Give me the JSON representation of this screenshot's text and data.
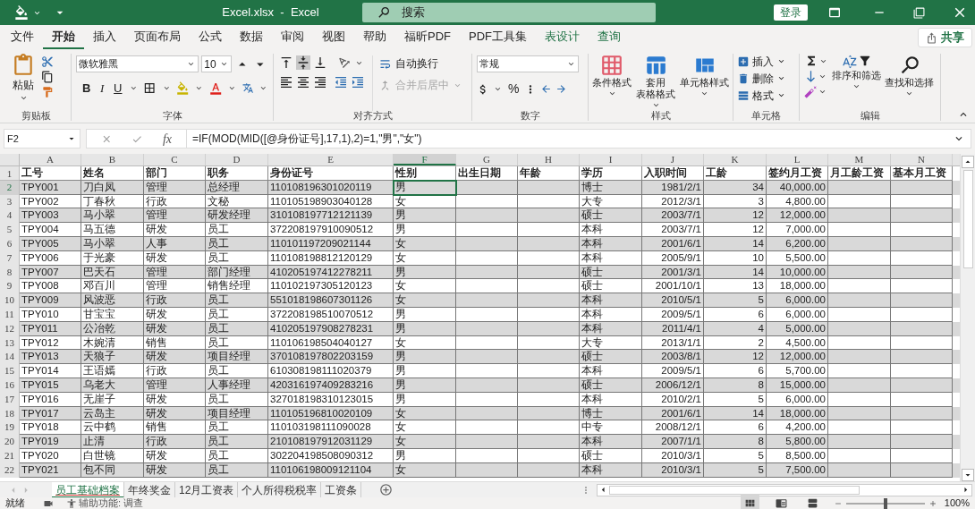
{
  "title_bar": {
    "title": "Excel.xlsx  -  Excel",
    "search": {
      "placeholder": "搜索"
    },
    "sign_in": "登录"
  },
  "menu_tabs": [
    {
      "label": "文件",
      "selected": false,
      "kind": "normal"
    },
    {
      "label": "开始",
      "selected": true,
      "kind": "normal"
    },
    {
      "label": "插入",
      "selected": false,
      "kind": "normal"
    },
    {
      "label": "页面布局",
      "selected": false,
      "kind": "normal"
    },
    {
      "label": "公式",
      "selected": false,
      "kind": "normal"
    },
    {
      "label": "数据",
      "selected": false,
      "kind": "normal"
    },
    {
      "label": "审阅",
      "selected": false,
      "kind": "normal"
    },
    {
      "label": "视图",
      "selected": false,
      "kind": "normal"
    },
    {
      "label": "帮助",
      "selected": false,
      "kind": "normal"
    },
    {
      "label": "福昕PDF",
      "selected": false,
      "kind": "normal"
    },
    {
      "label": "PDF工具集",
      "selected": false,
      "kind": "normal"
    },
    {
      "label": "表设计",
      "selected": false,
      "kind": "contextual"
    },
    {
      "label": "查询",
      "selected": false,
      "kind": "contextual"
    }
  ],
  "share_button": "共享",
  "ribbon": {
    "clipboard": {
      "paste": "粘贴",
      "label": "剪贴板"
    },
    "font": {
      "font_name": "微软雅黑",
      "font_size": "10",
      "bold": "B",
      "italic": "I",
      "underline": "U",
      "label": "字体"
    },
    "alignment": {
      "wrap_text": "自动换行",
      "merge_center": {
        "label": "合并后居中",
        "disabled": true
      },
      "label": "对齐方式"
    },
    "number": {
      "format": "常规",
      "percent": "%",
      "label": "数字"
    },
    "styles": {
      "items": [
        [
          "条件格式"
        ],
        [
          "套用",
          "表格格式"
        ],
        [
          "单元格样式"
        ]
      ],
      "label": "样式"
    },
    "cells": {
      "items": [
        "插入",
        "删除",
        "格式"
      ],
      "label": "单元格"
    },
    "editing": {
      "sort_filter": "排序和筛选",
      "find_select": "查找和选择",
      "label": "编辑"
    }
  },
  "formula_bar": {
    "name_box": "F2",
    "function_label": "fx",
    "formula": "=IF(MOD(MID([@身份证号],17,1),2)=1,\"男\",\"女\")"
  },
  "columns": [
    {
      "label": "A",
      "selected": false
    },
    {
      "label": "B",
      "selected": false
    },
    {
      "label": "C",
      "selected": false
    },
    {
      "label": "D",
      "selected": false
    },
    {
      "label": "E",
      "selected": false
    },
    {
      "label": "F",
      "selected": true
    },
    {
      "label": "G",
      "selected": false
    },
    {
      "label": "H",
      "selected": false
    },
    {
      "label": "I",
      "selected": false
    },
    {
      "label": "J",
      "selected": false
    },
    {
      "label": "K",
      "selected": false
    },
    {
      "label": "L",
      "selected": false
    },
    {
      "label": "M",
      "selected": false
    },
    {
      "label": "N",
      "selected": false
    }
  ],
  "header_row": {
    "row_number": "1",
    "cells": [
      "工号",
      "姓名",
      "部门",
      "职务",
      "身份证号",
      "性别",
      "出生日期",
      "年龄",
      "学历",
      "入职时间",
      "工龄",
      "签约月工资",
      "月工龄工资",
      "基本月工资"
    ]
  },
  "rows": [
    {
      "row_number": "2",
      "selected": true,
      "id": "TPY001",
      "name": "刀白凤",
      "dept": "管理",
      "position": "总经理",
      "id_number": "110108196301020119",
      "gender": "男",
      "education": "博士",
      "hire_date": "1981/2/1",
      "years": "34",
      "salary": "40,000.00"
    },
    {
      "row_number": "3",
      "selected": false,
      "id": "TPY002",
      "name": "丁春秋",
      "dept": "行政",
      "position": "文秘",
      "id_number": "110105198903040128",
      "gender": "女",
      "education": "大专",
      "hire_date": "2012/3/1",
      "years": "3",
      "salary": "4,800.00"
    },
    {
      "row_number": "4",
      "selected": false,
      "id": "TPY003",
      "name": "马小翠",
      "dept": "管理",
      "position": "研发经理",
      "id_number": "310108197712121139",
      "gender": "男",
      "education": "硕士",
      "hire_date": "2003/7/1",
      "years": "12",
      "salary": "12,000.00"
    },
    {
      "row_number": "5",
      "selected": false,
      "id": "TPY004",
      "name": "马五德",
      "dept": "研发",
      "position": "员工",
      "id_number": "372208197910090512",
      "gender": "男",
      "education": "本科",
      "hire_date": "2003/7/1",
      "years": "12",
      "salary": "7,000.00"
    },
    {
      "row_number": "6",
      "selected": false,
      "id": "TPY005",
      "name": "马小翠",
      "dept": "人事",
      "position": "员工",
      "id_number": "110101197209021144",
      "gender": "女",
      "education": "本科",
      "hire_date": "2001/6/1",
      "years": "14",
      "salary": "6,200.00"
    },
    {
      "row_number": "7",
      "selected": false,
      "id": "TPY006",
      "name": "于光豪",
      "dept": "研发",
      "position": "员工",
      "id_number": "110108198812120129",
      "gender": "女",
      "education": "本科",
      "hire_date": "2005/9/1",
      "years": "10",
      "salary": "5,500.00"
    },
    {
      "row_number": "8",
      "selected": false,
      "id": "TPY007",
      "name": "巴天石",
      "dept": "管理",
      "position": "部门经理",
      "id_number": "410205197412278211",
      "gender": "男",
      "education": "硕士",
      "hire_date": "2001/3/1",
      "years": "14",
      "salary": "10,000.00"
    },
    {
      "row_number": "9",
      "selected": false,
      "id": "TPY008",
      "name": "邓百川",
      "dept": "管理",
      "position": "销售经理",
      "id_number": "110102197305120123",
      "gender": "女",
      "education": "硕士",
      "hire_date": "2001/10/1",
      "years": "13",
      "salary": "18,000.00"
    },
    {
      "row_number": "10",
      "selected": false,
      "id": "TPY009",
      "name": "风波恶",
      "dept": "行政",
      "position": "员工",
      "id_number": "551018198607301126",
      "gender": "女",
      "education": "本科",
      "hire_date": "2010/5/1",
      "years": "5",
      "salary": "6,000.00"
    },
    {
      "row_number": "11",
      "selected": false,
      "id": "TPY010",
      "name": "甘宝宝",
      "dept": "研发",
      "position": "员工",
      "id_number": "372208198510070512",
      "gender": "男",
      "education": "本科",
      "hire_date": "2009/5/1",
      "years": "6",
      "salary": "6,000.00"
    },
    {
      "row_number": "12",
      "selected": false,
      "id": "TPY011",
      "name": "公冶乾",
      "dept": "研发",
      "position": "员工",
      "id_number": "410205197908278231",
      "gender": "男",
      "education": "本科",
      "hire_date": "2011/4/1",
      "years": "4",
      "salary": "5,000.00"
    },
    {
      "row_number": "13",
      "selected": false,
      "id": "TPY012",
      "name": "木婉清",
      "dept": "销售",
      "position": "员工",
      "id_number": "110106198504040127",
      "gender": "女",
      "education": "大专",
      "hire_date": "2013/1/1",
      "years": "2",
      "salary": "4,500.00"
    },
    {
      "row_number": "14",
      "selected": false,
      "id": "TPY013",
      "name": "天狼子",
      "dept": "研发",
      "position": "项目经理",
      "id_number": "370108197802203159",
      "gender": "男",
      "education": "硕士",
      "hire_date": "2003/8/1",
      "years": "12",
      "salary": "12,000.00"
    },
    {
      "row_number": "15",
      "selected": false,
      "id": "TPY014",
      "name": "王语嫣",
      "dept": "行政",
      "position": "员工",
      "id_number": "610308198111020379",
      "gender": "男",
      "education": "本科",
      "hire_date": "2009/5/1",
      "years": "6",
      "salary": "5,700.00"
    },
    {
      "row_number": "16",
      "selected": false,
      "id": "TPY015",
      "name": "乌老大",
      "dept": "管理",
      "position": "人事经理",
      "id_number": "420316197409283216",
      "gender": "男",
      "education": "硕士",
      "hire_date": "2006/12/1",
      "years": "8",
      "salary": "15,000.00"
    },
    {
      "row_number": "17",
      "selected": false,
      "id": "TPY016",
      "name": "无崖子",
      "dept": "研发",
      "position": "员工",
      "id_number": "327018198310123015",
      "gender": "男",
      "education": "本科",
      "hire_date": "2010/2/1",
      "years": "5",
      "salary": "6,000.00"
    },
    {
      "row_number": "18",
      "selected": false,
      "id": "TPY017",
      "name": "云岛主",
      "dept": "研发",
      "position": "项目经理",
      "id_number": "110105196810020109",
      "gender": "女",
      "education": "博士",
      "hire_date": "2001/6/1",
      "years": "14",
      "salary": "18,000.00"
    },
    {
      "row_number": "19",
      "selected": false,
      "id": "TPY018",
      "name": "云中鹤",
      "dept": "销售",
      "position": "员工",
      "id_number": "110103198111090028",
      "gender": "女",
      "education": "中专",
      "hire_date": "2008/12/1",
      "years": "6",
      "salary": "4,200.00"
    },
    {
      "row_number": "20",
      "selected": false,
      "id": "TPY019",
      "name": "止清",
      "dept": "行政",
      "position": "员工",
      "id_number": "210108197912031129",
      "gender": "女",
      "education": "本科",
      "hire_date": "2007/1/1",
      "years": "8",
      "salary": "5,800.00"
    },
    {
      "row_number": "21",
      "selected": false,
      "id": "TPY020",
      "name": "白世镜",
      "dept": "研发",
      "position": "员工",
      "id_number": "302204198508090312",
      "gender": "男",
      "education": "硕士",
      "hire_date": "2010/3/1",
      "years": "5",
      "salary": "8,500.00"
    },
    {
      "row_number": "22",
      "selected": false,
      "id": "TPY021",
      "name": "包不同",
      "dept": "研发",
      "position": "员工",
      "id_number": "110106198009121104",
      "gender": "女",
      "education": "本科",
      "hire_date": "2010/3/1",
      "years": "5",
      "salary": "7,500.00"
    }
  ],
  "sheet_tabs": [
    {
      "label": "员工基础档案",
      "selected": true
    },
    {
      "label": "年终奖金",
      "selected": false
    },
    {
      "label": "12月工资表",
      "selected": false
    },
    {
      "label": "个人所得税税率",
      "selected": false
    },
    {
      "label": "工资条",
      "selected": false
    }
  ],
  "status_bar": {
    "status": "就绪",
    "accessibility": "辅助功能: 调查",
    "views": [
      {
        "kind": "normal",
        "selected": true
      },
      {
        "kind": "page_layout",
        "selected": false
      },
      {
        "kind": "page_break",
        "selected": false
      }
    ],
    "zoom": {
      "level": 0.5,
      "label": "100%"
    }
  }
}
